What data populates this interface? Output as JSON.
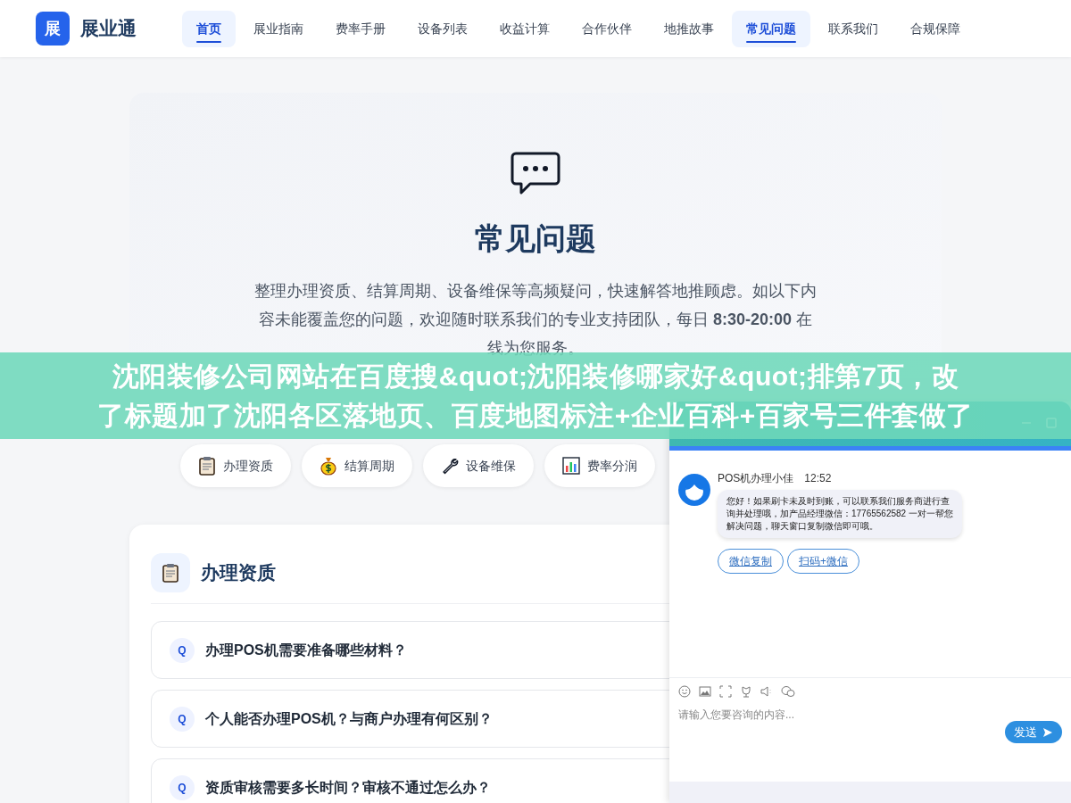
{
  "brand": {
    "logo_char": "展",
    "name": "展业通"
  },
  "nav": [
    {
      "label": "首页",
      "selected": true
    },
    {
      "label": "展业指南",
      "selected": false
    },
    {
      "label": "费率手册",
      "selected": false
    },
    {
      "label": "设备列表",
      "selected": false
    },
    {
      "label": "收益计算",
      "selected": false
    },
    {
      "label": "合作伙伴",
      "selected": false
    },
    {
      "label": "地推故事",
      "selected": false
    },
    {
      "label": "常见问题",
      "selected": true
    },
    {
      "label": "联系我们",
      "selected": false
    },
    {
      "label": "合规保障",
      "selected": false
    }
  ],
  "hero": {
    "title": "常见问题",
    "description": "整理办理资质、结算周期、设备维保等高频疑问，快速解答地推顾虑。如以下内容未能覆盖您的问题，欢迎随时联系我们的专业支持团队，每日 **8:30-20:00** 在线为您服务。"
  },
  "categories": [
    {
      "label": "办理资质",
      "kind": "clipboard"
    },
    {
      "label": "结算周期",
      "kind": "moneybag"
    },
    {
      "label": "设备维保",
      "kind": "wrench"
    },
    {
      "label": "费率分润",
      "kind": "chart"
    }
  ],
  "section": {
    "title": "办理资质",
    "questions": [
      {
        "badge": "Q",
        "text": "办理POS机需要准备哪些材料？"
      },
      {
        "badge": "Q",
        "text": "个人能否办理POS机？与商户办理有何区别？"
      },
      {
        "badge": "Q",
        "text": "资质审核需要多长时间？审核不通过怎么办？"
      }
    ]
  },
  "chat": {
    "sender": "POS机办理小佳",
    "time": "12:52",
    "message": "您好！如果刷卡未及时到账，可以联系我们服务商进行查询并处理哦，加产品经理微信：17765562582 一对一帮您解决问题，聊天窗口复制微信即可哦。",
    "actions": [
      "微信复制",
      "扫码+微信"
    ],
    "input_placeholder": "请输入您要咨询的内容...",
    "send_label": "发送"
  },
  "overlay_banner": {
    "lines": [
      "沈阳装修公司网站在百度搜&quot;沈阳装修哪家好&quot;排第7页，改",
      "了标题加了沈阳各区落地页、百度地图标注+企业百科+百家号三件套做了"
    ]
  }
}
